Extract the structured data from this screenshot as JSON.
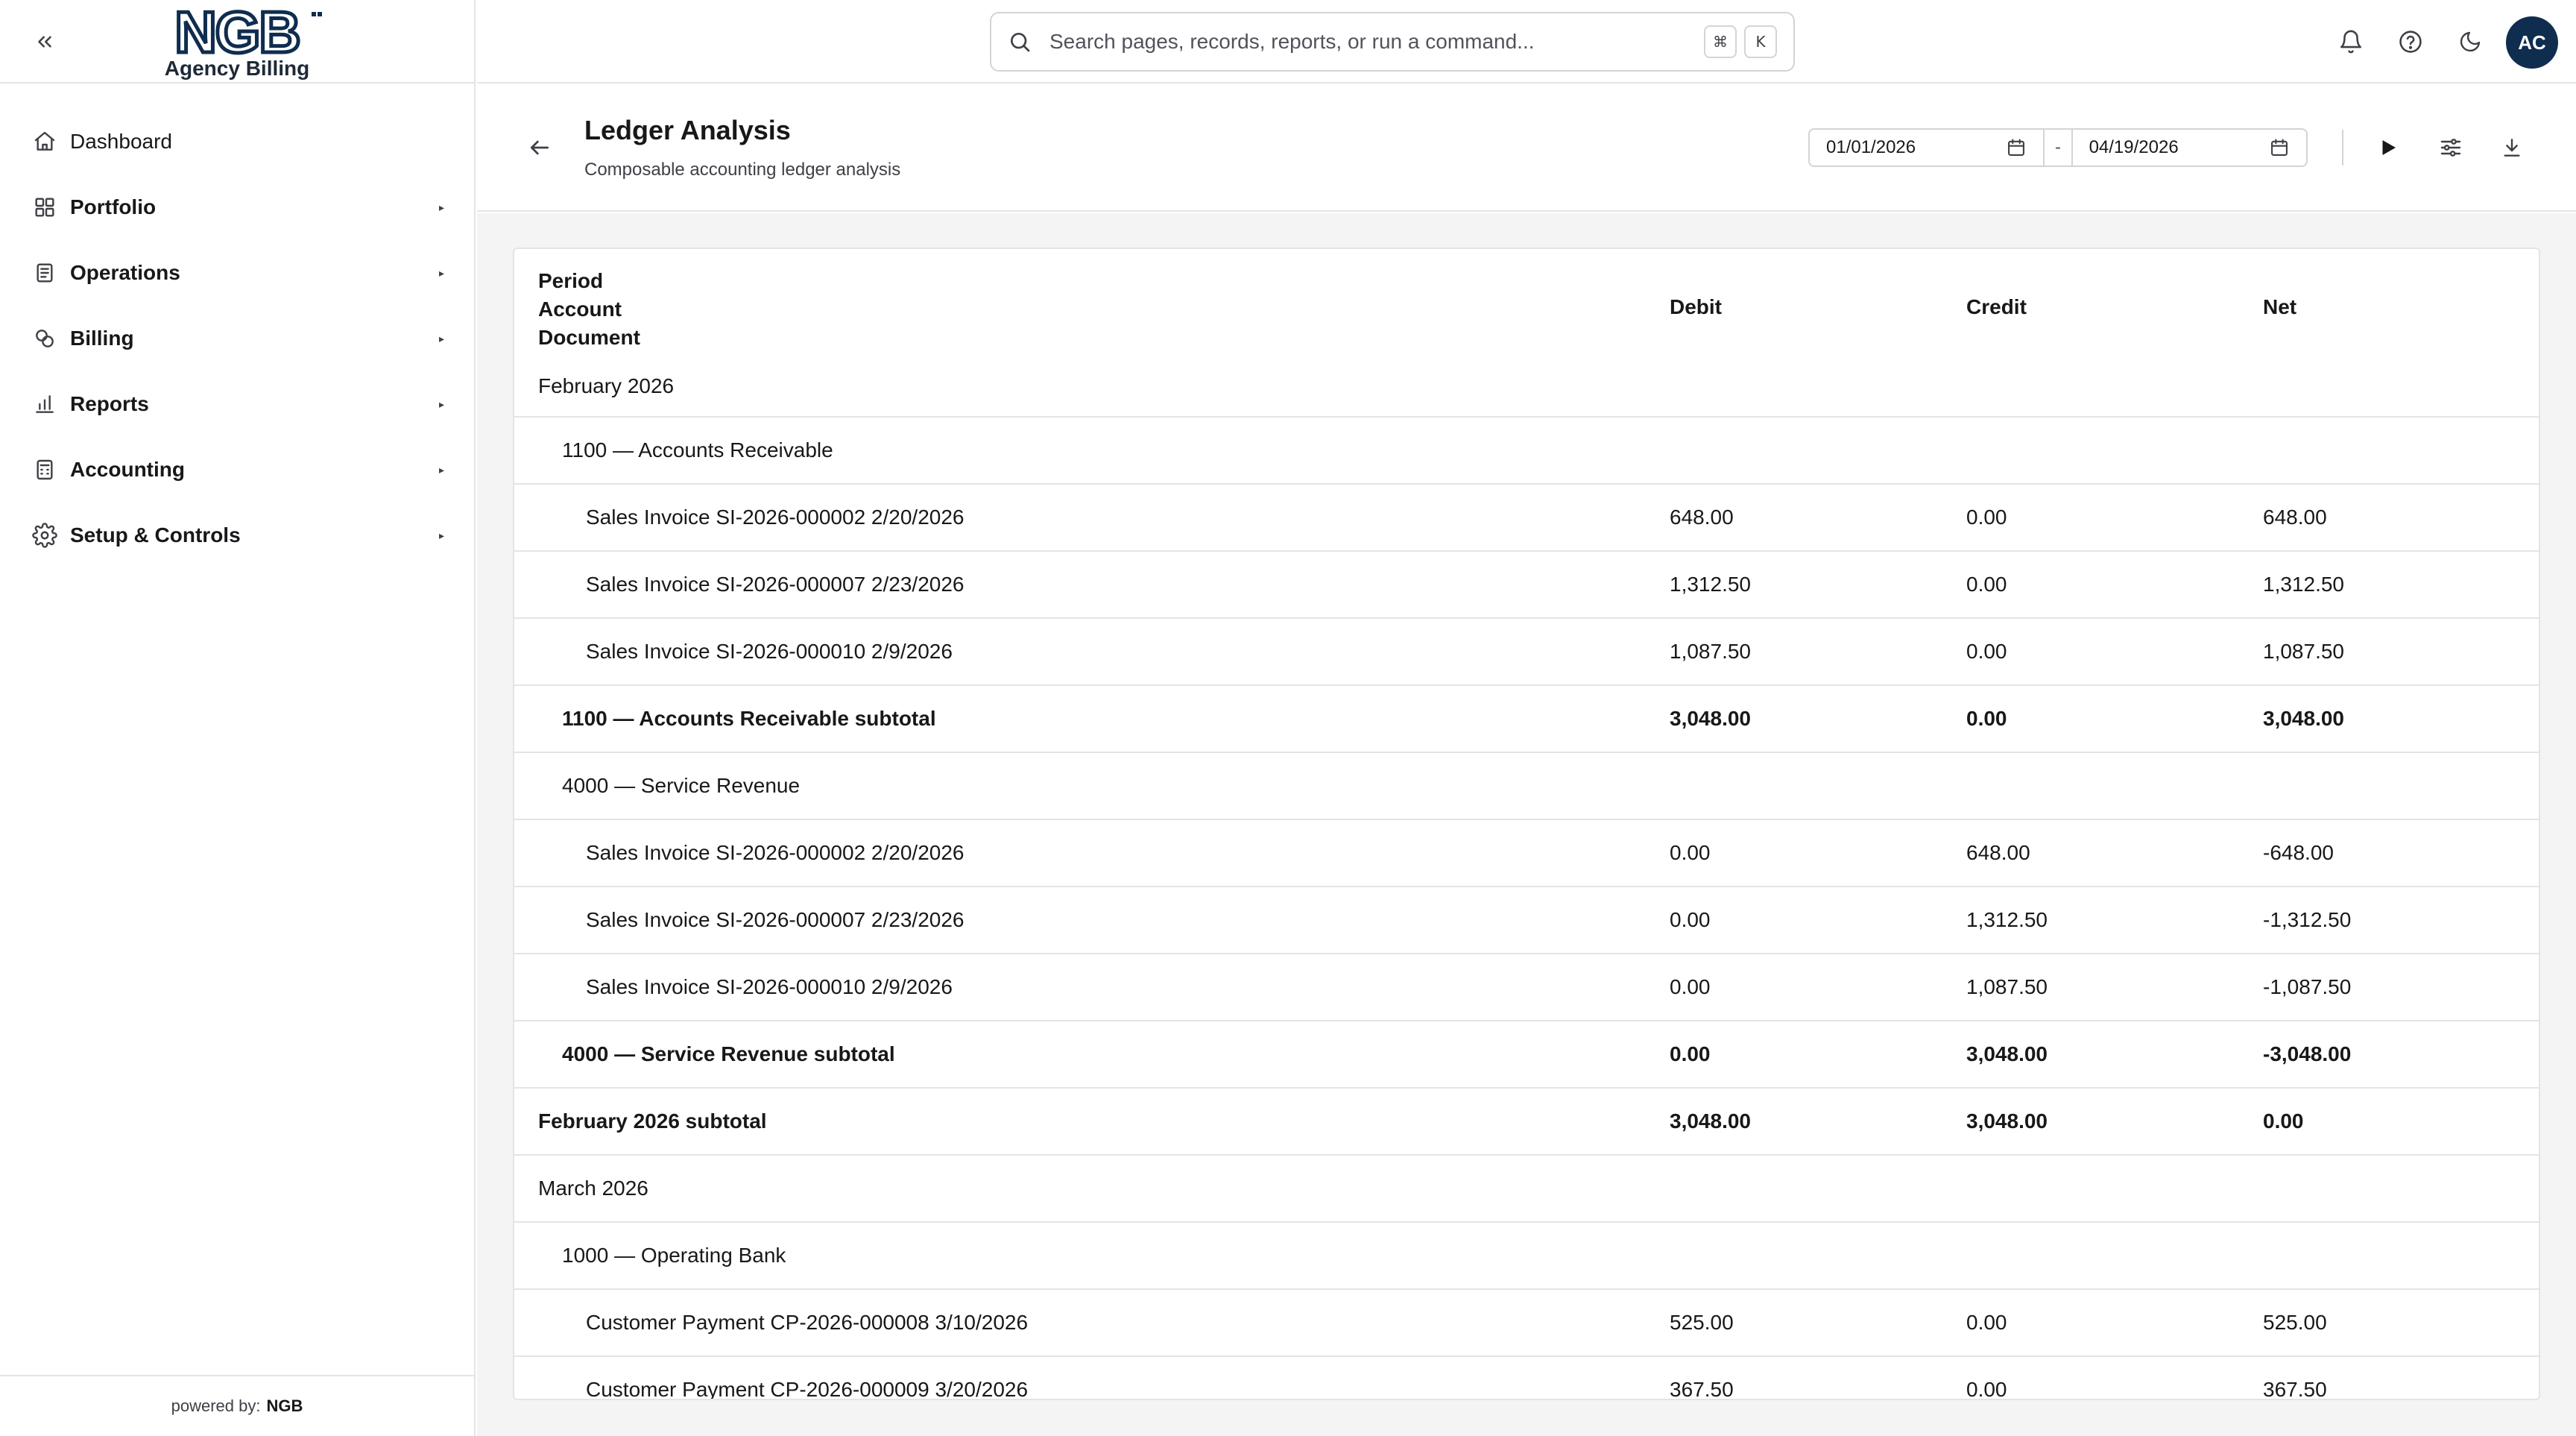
{
  "app": {
    "logo_text": "NGB",
    "logo_subtitle": "Agency Billing",
    "footer_prefix": "powered by:",
    "footer_brand": "NGB"
  },
  "sidebar": {
    "items": [
      {
        "label": "Dashboard",
        "icon": "home-icon",
        "bold": false,
        "expandable": false
      },
      {
        "label": "Portfolio",
        "icon": "grid-icon",
        "bold": true,
        "expandable": true
      },
      {
        "label": "Operations",
        "icon": "clipboard-icon",
        "bold": true,
        "expandable": true
      },
      {
        "label": "Billing",
        "icon": "coins-icon",
        "bold": true,
        "expandable": true
      },
      {
        "label": "Reports",
        "icon": "bar-chart-icon",
        "bold": true,
        "expandable": true
      },
      {
        "label": "Accounting",
        "icon": "calculator-icon",
        "bold": true,
        "expandable": true
      },
      {
        "label": "Setup & Controls",
        "icon": "gear-icon",
        "bold": true,
        "expandable": true
      }
    ]
  },
  "search": {
    "placeholder": "Search pages, records, reports, or run a command...",
    "shortcut_mod": "⌘",
    "shortcut_key": "K"
  },
  "user": {
    "initials": "AC"
  },
  "page": {
    "title": "Ledger Analysis",
    "subtitle": "Composable accounting ledger analysis",
    "date_from": "01/01/2026",
    "date_separator": "-",
    "date_to": "04/19/2026"
  },
  "table": {
    "group_headers": [
      "Period",
      "Account",
      "Document"
    ],
    "columns": [
      "Debit",
      "Credit",
      "Net"
    ],
    "rows": [
      {
        "level": 0,
        "label": "February 2026",
        "debit": "",
        "credit": "",
        "net": "",
        "bold": false
      },
      {
        "level": 1,
        "label": "1100 — Accounts Receivable",
        "debit": "",
        "credit": "",
        "net": "",
        "bold": false
      },
      {
        "level": 2,
        "label": "Sales Invoice SI-2026-000002 2/20/2026",
        "debit": "648.00",
        "credit": "0.00",
        "net": "648.00",
        "bold": false
      },
      {
        "level": 2,
        "label": "Sales Invoice SI-2026-000007 2/23/2026",
        "debit": "1,312.50",
        "credit": "0.00",
        "net": "1,312.50",
        "bold": false
      },
      {
        "level": 2,
        "label": "Sales Invoice SI-2026-000010 2/9/2026",
        "debit": "1,087.50",
        "credit": "0.00",
        "net": "1,087.50",
        "bold": false
      },
      {
        "level": 1,
        "label": "1100 — Accounts Receivable subtotal",
        "debit": "3,048.00",
        "credit": "0.00",
        "net": "3,048.00",
        "bold": true
      },
      {
        "level": 1,
        "label": "4000 — Service Revenue",
        "debit": "",
        "credit": "",
        "net": "",
        "bold": false
      },
      {
        "level": 2,
        "label": "Sales Invoice SI-2026-000002 2/20/2026",
        "debit": "0.00",
        "credit": "648.00",
        "net": "-648.00",
        "bold": false
      },
      {
        "level": 2,
        "label": "Sales Invoice SI-2026-000007 2/23/2026",
        "debit": "0.00",
        "credit": "1,312.50",
        "net": "-1,312.50",
        "bold": false
      },
      {
        "level": 2,
        "label": "Sales Invoice SI-2026-000010 2/9/2026",
        "debit": "0.00",
        "credit": "1,087.50",
        "net": "-1,087.50",
        "bold": false
      },
      {
        "level": 1,
        "label": "4000 — Service Revenue subtotal",
        "debit": "0.00",
        "credit": "3,048.00",
        "net": "-3,048.00",
        "bold": true
      },
      {
        "level": 0,
        "label": "February 2026 subtotal",
        "debit": "3,048.00",
        "credit": "3,048.00",
        "net": "0.00",
        "bold": true
      },
      {
        "level": 0,
        "label": "March 2026",
        "debit": "",
        "credit": "",
        "net": "",
        "bold": false
      },
      {
        "level": 1,
        "label": "1000 — Operating Bank",
        "debit": "",
        "credit": "",
        "net": "",
        "bold": false
      },
      {
        "level": 2,
        "label": "Customer Payment CP-2026-000008 3/10/2026",
        "debit": "525.00",
        "credit": "0.00",
        "net": "525.00",
        "bold": false
      },
      {
        "level": 2,
        "label": "Customer Payment CP-2026-000009 3/20/2026",
        "debit": "367.50",
        "credit": "0.00",
        "net": "367.50",
        "bold": false
      }
    ]
  },
  "colors": {
    "brand_navy": "#0f2d4f",
    "border": "#e4e4e7",
    "content_bg": "#f4f4f5"
  }
}
